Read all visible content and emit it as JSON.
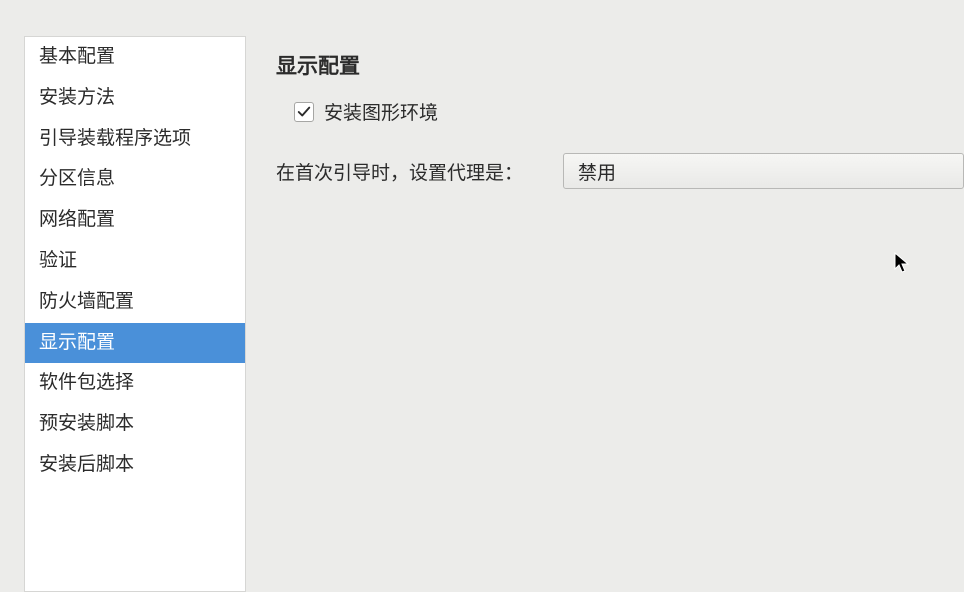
{
  "sidebar": {
    "items": [
      {
        "label": "基本配置"
      },
      {
        "label": "安装方法"
      },
      {
        "label": "引导装载程序选项"
      },
      {
        "label": "分区信息"
      },
      {
        "label": "网络配置"
      },
      {
        "label": "验证"
      },
      {
        "label": "防火墙配置"
      },
      {
        "label": "显示配置"
      },
      {
        "label": "软件包选择"
      },
      {
        "label": "预安装脚本"
      },
      {
        "label": "安装后脚本"
      }
    ],
    "selected_index": 7
  },
  "main": {
    "heading": "显示配置",
    "checkbox_label": "安装图形环境",
    "checkbox_checked": true,
    "agent_label": "在首次引导时，设置代理是：",
    "agent_select_value": "禁用"
  }
}
